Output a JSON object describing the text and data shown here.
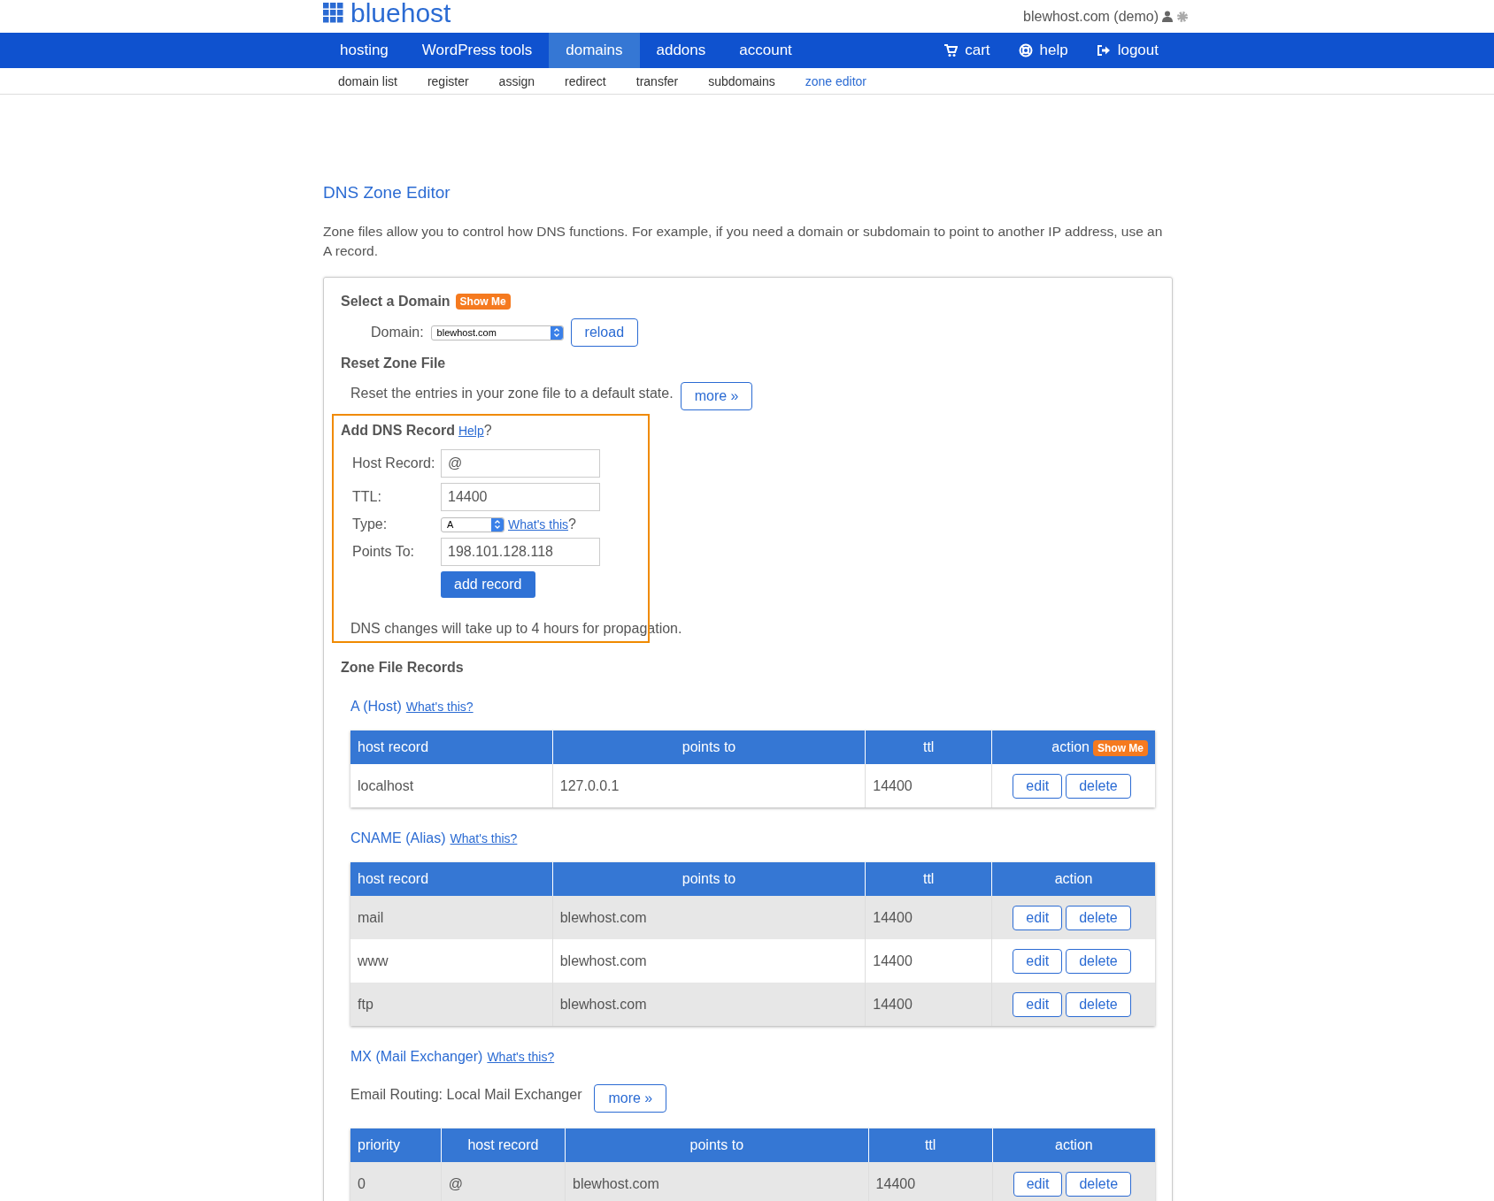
{
  "header": {
    "logo": "bluehost",
    "account": "blewhost.com (demo)"
  },
  "nav": {
    "items": [
      {
        "label": "hosting",
        "selected": false
      },
      {
        "label": "WordPress tools",
        "selected": false
      },
      {
        "label": "domains",
        "selected": true
      },
      {
        "label": "addons",
        "selected": false
      },
      {
        "label": "account",
        "selected": false
      }
    ],
    "right": [
      {
        "kind": "cart",
        "label": "cart"
      },
      {
        "kind": "help",
        "label": "help"
      },
      {
        "kind": "logout",
        "label": "logout"
      }
    ]
  },
  "subnav": [
    {
      "label": "domain list",
      "selected": false
    },
    {
      "label": "register",
      "selected": false
    },
    {
      "label": "assign",
      "selected": false
    },
    {
      "label": "redirect",
      "selected": false
    },
    {
      "label": "transfer",
      "selected": false
    },
    {
      "label": "subdomains",
      "selected": false
    },
    {
      "label": "zone editor",
      "selected": true
    }
  ],
  "page_title": "DNS Zone Editor",
  "intro": "Zone files allow you to control how DNS functions. For example, if you need a domain or subdomain to point to another IP address, use an A record.",
  "select_domain": {
    "title": "Select a Domain",
    "badge": "Show Me",
    "label": "Domain:",
    "value": "blewhost.com",
    "button": "reload"
  },
  "reset_zone": {
    "title": "Reset Zone File",
    "text": "Reset the entries in your zone file to a default state.",
    "button": "more »"
  },
  "add_record": {
    "highlighted": true,
    "title": "Add DNS Record",
    "help_link": "Help",
    "help_suffix": "?",
    "fields": [
      {
        "kind": "text",
        "label": "Host Record:",
        "value": "@"
      },
      {
        "kind": "text",
        "label": "TTL:",
        "value": "14400"
      },
      {
        "kind": "select",
        "label": "Type:",
        "value": "A",
        "link": "What's this",
        "suffix": "?"
      },
      {
        "kind": "text",
        "label": "Points To:",
        "value": "198.101.128.118"
      }
    ],
    "button": "add record",
    "note": "DNS changes will take up to 4 hours for propagation."
  },
  "zone_records": {
    "title": "Zone File Records",
    "sections": [
      {
        "title": "A (Host)",
        "link": "What's this?",
        "columns": [
          {
            "label": "host record"
          },
          {
            "label": "points to"
          },
          {
            "label": "ttl"
          },
          {
            "label": "action",
            "badge": "Show Me"
          }
        ],
        "rows": [
          {
            "shaded": false,
            "cells": [
              "localhost",
              "127.0.0.1",
              "14400"
            ],
            "actions": [
              "edit",
              "delete"
            ]
          }
        ]
      },
      {
        "title": "CNAME (Alias)",
        "link": "What's this?",
        "columns": [
          {
            "label": "host record"
          },
          {
            "label": "points to"
          },
          {
            "label": "ttl"
          },
          {
            "label": "action"
          }
        ],
        "rows": [
          {
            "shaded": true,
            "cells": [
              "mail",
              "blewhost.com",
              "14400"
            ],
            "actions": [
              "edit",
              "delete"
            ]
          },
          {
            "shaded": false,
            "cells": [
              "www",
              "blewhost.com",
              "14400"
            ],
            "actions": [
              "edit",
              "delete"
            ]
          },
          {
            "shaded": true,
            "cells": [
              "ftp",
              "blewhost.com",
              "14400"
            ],
            "actions": [
              "edit",
              "delete"
            ]
          }
        ]
      },
      {
        "title": "MX (Mail Exchanger)",
        "link": "What's this?",
        "note": "Email Routing: Local Mail Exchanger",
        "note_button": "more »",
        "columns": [
          {
            "label": "priority"
          },
          {
            "label": "host record"
          },
          {
            "label": "points to"
          },
          {
            "label": "ttl"
          },
          {
            "label": "action"
          }
        ],
        "rows": [
          {
            "shaded": true,
            "cells": [
              "0",
              "@",
              "blewhost.com",
              "14400"
            ],
            "actions": [
              "edit",
              "delete"
            ]
          }
        ]
      }
    ]
  }
}
